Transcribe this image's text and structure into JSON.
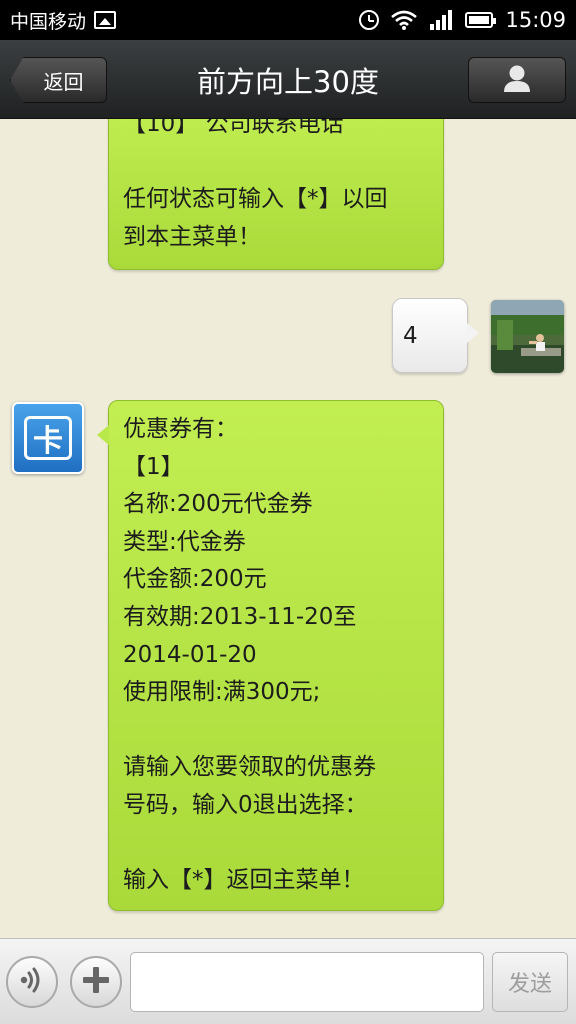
{
  "status_bar": {
    "carrier": "中国移动",
    "time": "15:09",
    "icons": [
      "image-icon",
      "alarm-icon",
      "wifi-icon",
      "signal-icon",
      "battery-icon"
    ]
  },
  "nav": {
    "back_label": "返回",
    "title": "前方向上30度",
    "right_icon": "person-icon"
  },
  "messages": [
    {
      "sender": "bot",
      "lines": [
        "【10】 公司联系电话",
        "",
        "任何状态可输入【*】以回",
        "到本主菜单！"
      ]
    },
    {
      "sender": "user",
      "text": "4"
    },
    {
      "sender": "bot",
      "avatar_text": "卡",
      "lines": [
        "优惠券有：",
        "【1】",
        "名称:200元代金券",
        "类型:代金券",
        "代金额:200元",
        "有效期:2013-11-20至",
        "2014-01-20",
        "使用限制:满300元;",
        "",
        "请输入您要领取的优惠券",
        "号码，输入0退出选择：",
        "",
        "输入【*】返回主菜单！"
      ]
    }
  ],
  "input_bar": {
    "input_value": "",
    "send_label": "发送",
    "left_icons": [
      "voice-icon",
      "plus-icon"
    ]
  },
  "colors": {
    "bubble_green": "#b5e547",
    "background": "#efecda",
    "nav_dark": "#2b2d2e"
  }
}
